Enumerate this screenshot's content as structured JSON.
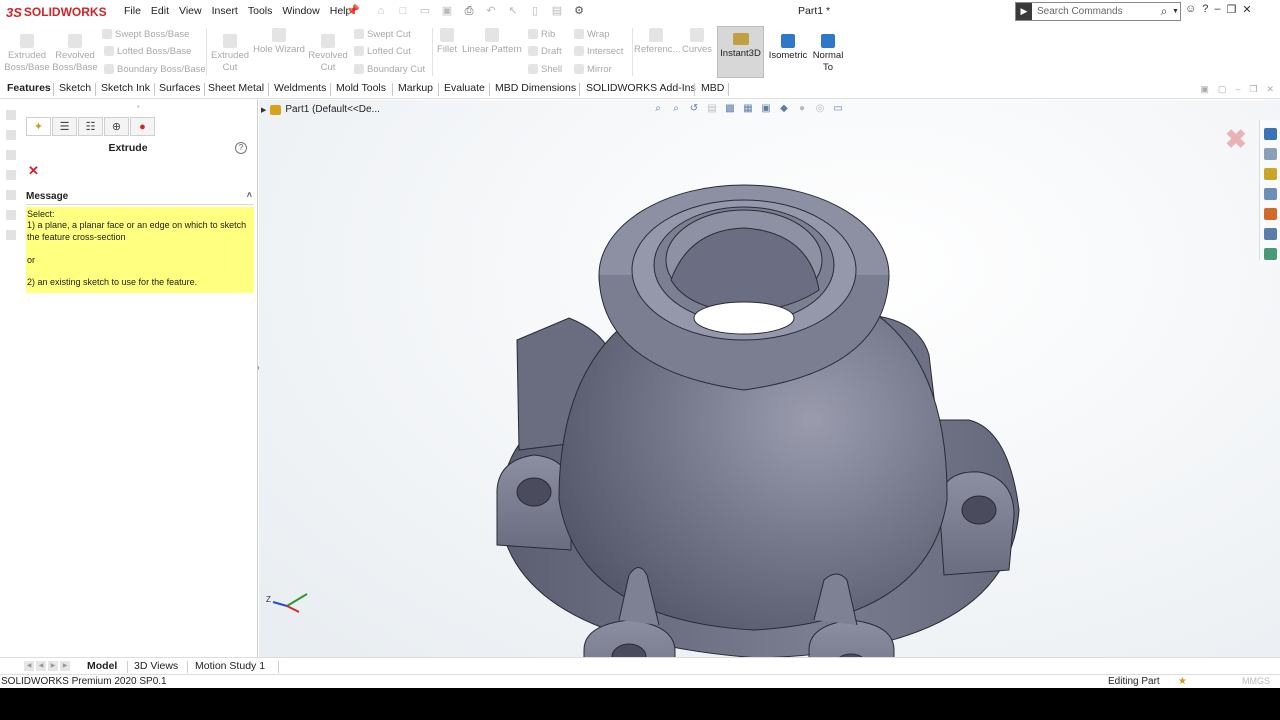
{
  "app": {
    "logo_ds": "3S",
    "logo_text": "SOLIDWORKS",
    "doc_title": "Part1 *",
    "menu": [
      "File",
      "Edit",
      "View",
      "Insert",
      "Tools",
      "Window",
      "Help"
    ],
    "search_placeholder": "Search Commands"
  },
  "command_manager": {
    "extruded_boss": "Extruded Boss/Base",
    "revolved_boss": "Revolved Boss/Base",
    "swept_boss": "Swept Boss/Base",
    "lofted_boss": "Lofted Boss/Base",
    "boundary_boss": "Boundary Boss/Base",
    "extruded_cut": "Extruded Cut",
    "hole_wizard": "Hole Wizard",
    "revolved_cut": "Revolved Cut",
    "swept_cut": "Swept Cut",
    "lofted_cut": "Lofted Cut",
    "boundary_cut": "Boundary Cut",
    "fillet": "Fillet",
    "linear_pattern": "Linear Pattern",
    "rib": "Rib",
    "draft": "Draft",
    "shell": "Shell",
    "wrap": "Wrap",
    "intersect": "Intersect",
    "mirror": "Mirror",
    "reference": "Referenc...",
    "curves": "Curves",
    "instant3d": "Instant3D",
    "isometric": "Isometric",
    "normal_to_1": "Normal",
    "normal_to_2": "To"
  },
  "tabs": [
    "Features",
    "Sketch",
    "Sketch Ink",
    "Surfaces",
    "Sheet Metal",
    "Weldments",
    "Mold Tools",
    "Markup",
    "Evaluate",
    "MBD Dimensions",
    "SOLIDWORKS Add-Ins",
    "MBD"
  ],
  "property_manager": {
    "title": "Extrude",
    "help": "?",
    "message_header": "Message",
    "message_lines": [
      "Select:",
      "1) a plane, a planar face or an edge on which to sketch",
      "the feature cross-section",
      "",
      "or",
      "",
      "2) an existing sketch to use for the feature."
    ]
  },
  "tree": {
    "root": "Part1  (Default<<De..."
  },
  "triad_label": "Z",
  "bottom_tabs": [
    "Model",
    "3D Views",
    "Motion Study 1"
  ],
  "status": {
    "left": "SOLIDWORKS Premium 2020 SP0.1",
    "mode": "Editing Part",
    "units": "MMGS"
  },
  "colors": {
    "brand_red": "#d2232a",
    "message_bg": "#ffff80",
    "part_gray": "#7c7e93"
  }
}
